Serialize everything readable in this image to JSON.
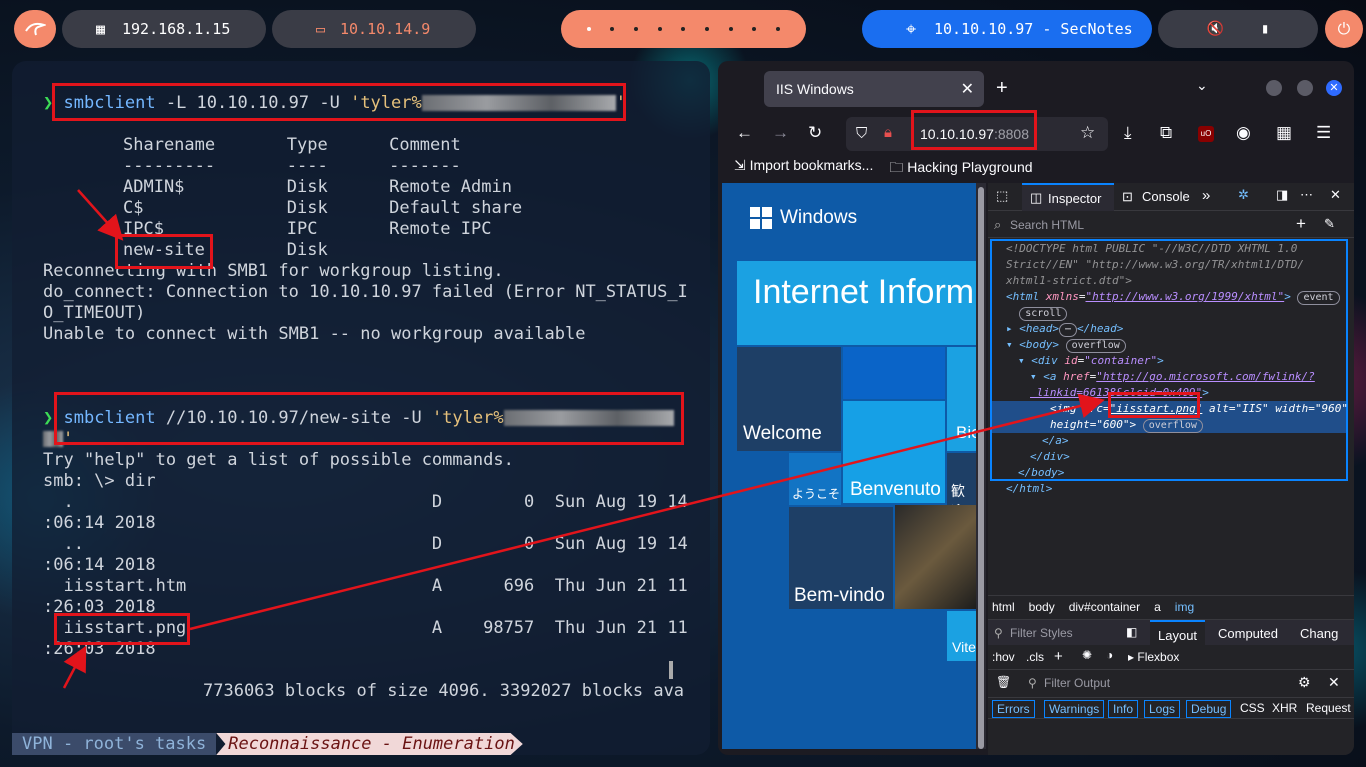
{
  "topbar": {
    "local_ip": "192.168.1.15",
    "vpn_ip": "10.10.14.9",
    "target": "10.10.10.97 - SecNotes"
  },
  "terminal": {
    "cmd1": "smbclient",
    "cmd1_args": " -L 10.10.10.97 -U ",
    "cmd1_str": "'tyler%",
    "share_header": "Sharename       Type      Comment",
    "share_sep": "---------       ----      -------",
    "shares": [
      "ADMIN$          Disk      Remote Admin",
      "C$              Disk      Default share",
      "IPC$            IPC       Remote IPC",
      "new-site        Disk"
    ],
    "out1": [
      "Reconnecting with SMB1 for workgroup listing.",
      "do_connect: Connection to 10.10.10.97 failed (Error NT_STATUS_I",
      "O_TIMEOUT)",
      "Unable to connect with SMB1 -- no workgroup available"
    ],
    "cmd2": "smbclient",
    "cmd2_args": " //10.10.10.97/new-site -U ",
    "cmd2_str": "'tyler%",
    "out2": [
      "Try \"help\" to get a list of possible commands.",
      "smb: \\> dir",
      "  .                                   D        0  Sun Aug 19 14",
      ":06:14 2018",
      "  ..                                  D        0  Sun Aug 19 14",
      ":06:14 2018",
      "  iisstart.htm                        A      696  Thu Jun 21 11",
      ":26:03 2018",
      "  iisstart.png                        A    98757  Thu Jun 21 11",
      ":26:03 2018"
    ],
    "blocks": "7736063 blocks of size 4096. 3392027 blocks ava"
  },
  "status": {
    "left": "VPN - root's tasks",
    "right": "Reconnaissance - Enumeration"
  },
  "browser": {
    "tab_title": "IIS Windows",
    "url_host": "10.10.10.97",
    "url_port": ":8808",
    "bookmarks": [
      "Import bookmarks...",
      "Hacking Playground"
    ],
    "page": {
      "brand": "Windows",
      "banner": "Internet Inform",
      "tiles": [
        "Welcome",
        "ようこそ",
        "Benvenuto",
        "歓迎",
        "Bem-vindo",
        "Bie",
        "Vite"
      ]
    }
  },
  "devtools": {
    "tabs": [
      "Inspector",
      "Console"
    ],
    "search_placeholder": "Search HTML",
    "breadcrumbs": [
      "html",
      "body",
      "div#container",
      "a",
      "img"
    ],
    "filter_styles": "Filter Styles",
    "style_tabs": [
      "Layout",
      "Computed",
      "Chang"
    ],
    "flexbox": "Flexbox",
    "filter_output": "Filter Output",
    "console_filters": [
      "Errors",
      "Warnings",
      "Info",
      "Logs",
      "Debug",
      "CSS",
      "XHR",
      "Request"
    ]
  }
}
